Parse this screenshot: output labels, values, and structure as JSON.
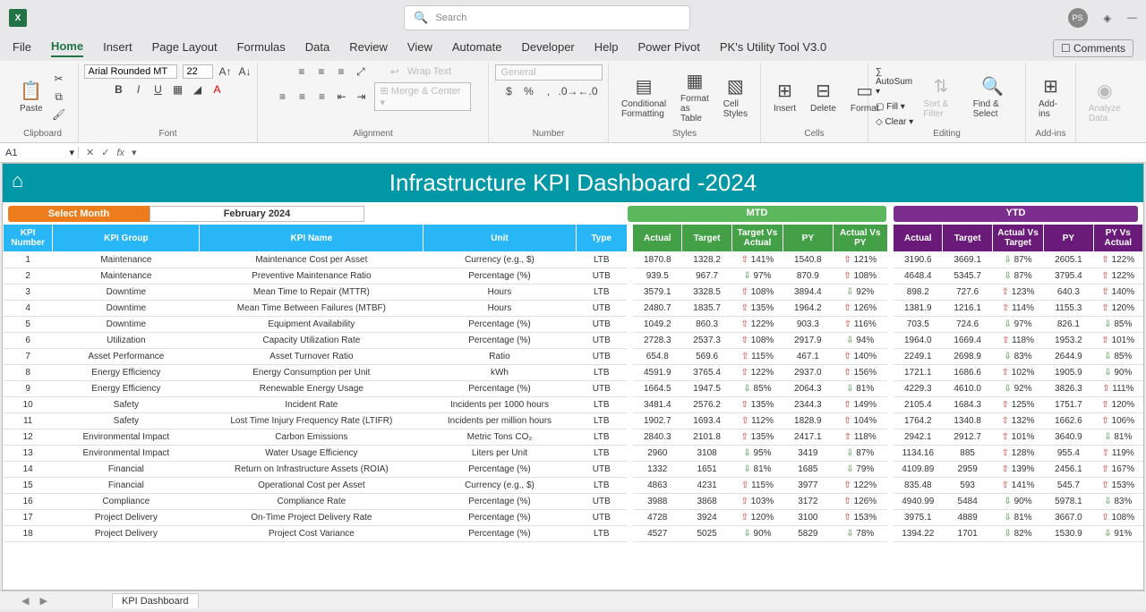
{
  "titlebar": {
    "search_placeholder": "Search",
    "avatar": "PS"
  },
  "menu": [
    "File",
    "Home",
    "Insert",
    "Page Layout",
    "Formulas",
    "Data",
    "Review",
    "View",
    "Automate",
    "Developer",
    "Help",
    "Power Pivot",
    "PK's Utility Tool V3.0"
  ],
  "comments_label": "Comments",
  "ribbon": {
    "paste": "Paste",
    "font_name": "Arial Rounded MT",
    "font_size": "22",
    "wrap_text": "Wrap Text",
    "merge_center": "Merge & Center",
    "general": "General",
    "conditional": "Conditional Formatting",
    "format_table": "Format as Table",
    "cell_styles": "Cell Styles",
    "insert": "Insert",
    "delete": "Delete",
    "format": "Format",
    "autosum": "AutoSum",
    "fill": "Fill",
    "clear": "Clear",
    "sort_filter": "Sort & Filter",
    "find_select": "Find & Select",
    "addins": "Add-ins",
    "analyze": "Analyze Data",
    "groups": {
      "clipboard": "Clipboard",
      "font": "Font",
      "alignment": "Alignment",
      "number": "Number",
      "styles": "Styles",
      "cells": "Cells",
      "editing": "Editing",
      "addins": "Add-ins"
    }
  },
  "cell_ref": "A1",
  "dashboard": {
    "title": "Infrastructure KPI Dashboard -2024",
    "select_month_label": "Select Month",
    "select_month_value": "February 2024",
    "mtd_label": "MTD",
    "ytd_label": "YTD"
  },
  "headers": {
    "kpi_number": "KPI Number",
    "kpi_group": "KPI Group",
    "kpi_name": "KPI Name",
    "unit": "Unit",
    "type": "Type",
    "actual": "Actual",
    "target": "Target",
    "target_vs_actual": "Target Vs Actual",
    "py": "PY",
    "actual_vs_py": "Actual Vs PY",
    "ytd_actual": "Actual",
    "ytd_target": "Target",
    "ytd_avt": "Actual Vs Target",
    "ytd_py": "PY",
    "py_vs_actual": "PY Vs Actual"
  },
  "rows": [
    {
      "n": "1",
      "g": "Maintenance",
      "name": "Maintenance Cost per Asset",
      "unit": "Currency (e.g., $)",
      "type": "LTB",
      "m": [
        "1870.8",
        "1328.2",
        "⇧ 141%",
        "1540.8",
        "⇧ 121%"
      ],
      "y": [
        "3190.6",
        "3669.1",
        "⇩ 87%",
        "2605.1",
        "⇧ 122%"
      ]
    },
    {
      "n": "2",
      "g": "Maintenance",
      "name": "Preventive Maintenance Ratio",
      "unit": "Percentage (%)",
      "type": "UTB",
      "m": [
        "939.5",
        "967.7",
        "⇩ 97%",
        "870.9",
        "⇧ 108%"
      ],
      "y": [
        "4648.4",
        "5345.7",
        "⇩ 87%",
        "3795.4",
        "⇧ 122%"
      ]
    },
    {
      "n": "3",
      "g": "Downtime",
      "name": "Mean Time to Repair (MTTR)",
      "unit": "Hours",
      "type": "LTB",
      "m": [
        "3579.1",
        "3328.5",
        "⇧ 108%",
        "3894.4",
        "⇩ 92%"
      ],
      "y": [
        "898.2",
        "727.6",
        "⇧ 123%",
        "640.3",
        "⇧ 140%"
      ]
    },
    {
      "n": "4",
      "g": "Downtime",
      "name": "Mean Time Between Failures (MTBF)",
      "unit": "Hours",
      "type": "UTB",
      "m": [
        "2480.7",
        "1835.7",
        "⇧ 135%",
        "1964.2",
        "⇧ 126%"
      ],
      "y": [
        "1381.9",
        "1216.1",
        "⇧ 114%",
        "1155.3",
        "⇧ 120%"
      ]
    },
    {
      "n": "5",
      "g": "Downtime",
      "name": "Equipment Availability",
      "unit": "Percentage (%)",
      "type": "UTB",
      "m": [
        "1049.2",
        "860.3",
        "⇧ 122%",
        "903.3",
        "⇧ 116%"
      ],
      "y": [
        "703.5",
        "724.6",
        "⇩ 97%",
        "826.1",
        "⇩ 85%"
      ]
    },
    {
      "n": "6",
      "g": "Utilization",
      "name": "Capacity Utilization Rate",
      "unit": "Percentage (%)",
      "type": "UTB",
      "m": [
        "2728.3",
        "2537.3",
        "⇧ 108%",
        "2917.9",
        "⇩ 94%"
      ],
      "y": [
        "1964.0",
        "1669.4",
        "⇧ 118%",
        "1953.2",
        "⇧ 101%"
      ]
    },
    {
      "n": "7",
      "g": "Asset Performance",
      "name": "Asset Turnover Ratio",
      "unit": "Ratio",
      "type": "UTB",
      "m": [
        "654.8",
        "569.6",
        "⇧ 115%",
        "467.1",
        "⇧ 140%"
      ],
      "y": [
        "2249.1",
        "2698.9",
        "⇩ 83%",
        "2644.9",
        "⇩ 85%"
      ]
    },
    {
      "n": "8",
      "g": "Energy Efficiency",
      "name": "Energy Consumption per Unit",
      "unit": "kWh",
      "type": "LTB",
      "m": [
        "4591.9",
        "3765.4",
        "⇧ 122%",
        "2937.0",
        "⇧ 156%"
      ],
      "y": [
        "1721.1",
        "1686.6",
        "⇧ 102%",
        "1905.9",
        "⇩ 90%"
      ]
    },
    {
      "n": "9",
      "g": "Energy Efficiency",
      "name": "Renewable Energy Usage",
      "unit": "Percentage (%)",
      "type": "UTB",
      "m": [
        "1664.5",
        "1947.5",
        "⇩ 85%",
        "2064.3",
        "⇩ 81%"
      ],
      "y": [
        "4229.3",
        "4610.0",
        "⇩ 92%",
        "3826.3",
        "⇧ 111%"
      ]
    },
    {
      "n": "10",
      "g": "Safety",
      "name": "Incident Rate",
      "unit": "Incidents per 1000 hours",
      "type": "LTB",
      "m": [
        "3481.4",
        "2576.2",
        "⇧ 135%",
        "2344.3",
        "⇧ 149%"
      ],
      "y": [
        "2105.4",
        "1684.3",
        "⇧ 125%",
        "1751.7",
        "⇧ 120%"
      ]
    },
    {
      "n": "11",
      "g": "Safety",
      "name": "Lost Time Injury Frequency Rate (LTIFR)",
      "unit": "Incidents per million hours",
      "type": "LTB",
      "m": [
        "1902.7",
        "1693.4",
        "⇧ 112%",
        "1828.9",
        "⇧ 104%"
      ],
      "y": [
        "1764.2",
        "1340.8",
        "⇧ 132%",
        "1662.6",
        "⇧ 106%"
      ]
    },
    {
      "n": "12",
      "g": "Environmental Impact",
      "name": "Carbon Emissions",
      "unit": "Metric Tons CO₂",
      "type": "LTB",
      "m": [
        "2840.3",
        "2101.8",
        "⇧ 135%",
        "2417.1",
        "⇧ 118%"
      ],
      "y": [
        "2942.1",
        "2912.7",
        "⇧ 101%",
        "3640.9",
        "⇩ 81%"
      ]
    },
    {
      "n": "13",
      "g": "Environmental Impact",
      "name": "Water Usage Efficiency",
      "unit": "Liters per Unit",
      "type": "LTB",
      "m": [
        "2960",
        "3108",
        "⇩ 95%",
        "3419",
        "⇩ 87%"
      ],
      "y": [
        "1134.16",
        "885",
        "⇧ 128%",
        "955.4",
        "⇧ 119%"
      ]
    },
    {
      "n": "14",
      "g": "Financial",
      "name": "Return on Infrastructure Assets (ROIA)",
      "unit": "Percentage (%)",
      "type": "UTB",
      "m": [
        "1332",
        "1651",
        "⇩ 81%",
        "1685",
        "⇩ 79%"
      ],
      "y": [
        "4109.89",
        "2959",
        "⇧ 139%",
        "2456.1",
        "⇧ 167%"
      ]
    },
    {
      "n": "15",
      "g": "Financial",
      "name": "Operational Cost per Asset",
      "unit": "Currency (e.g., $)",
      "type": "LTB",
      "m": [
        "4863",
        "4231",
        "⇧ 115%",
        "3977",
        "⇧ 122%"
      ],
      "y": [
        "835.48",
        "593",
        "⇧ 141%",
        "545.7",
        "⇧ 153%"
      ]
    },
    {
      "n": "16",
      "g": "Compliance",
      "name": "Compliance Rate",
      "unit": "Percentage (%)",
      "type": "UTB",
      "m": [
        "3988",
        "3868",
        "⇧ 103%",
        "3172",
        "⇧ 126%"
      ],
      "y": [
        "4940.99",
        "5484",
        "⇩ 90%",
        "5978.1",
        "⇩ 83%"
      ]
    },
    {
      "n": "17",
      "g": "Project Delivery",
      "name": "On-Time Project Delivery Rate",
      "unit": "Percentage (%)",
      "type": "UTB",
      "m": [
        "4728",
        "3924",
        "⇧ 120%",
        "3100",
        "⇧ 153%"
      ],
      "y": [
        "3975.1",
        "4889",
        "⇩ 81%",
        "3667.0",
        "⇧ 108%"
      ]
    },
    {
      "n": "18",
      "g": "Project Delivery",
      "name": "Project Cost Variance",
      "unit": "Percentage (%)",
      "type": "LTB",
      "m": [
        "4527",
        "5025",
        "⇩ 90%",
        "5829",
        "⇩ 78%"
      ],
      "y": [
        "1394.22",
        "1701",
        "⇩ 82%",
        "1530.9",
        "⇩ 91%"
      ]
    }
  ],
  "sheet_tabs": [
    "KPI Dashboard"
  ]
}
